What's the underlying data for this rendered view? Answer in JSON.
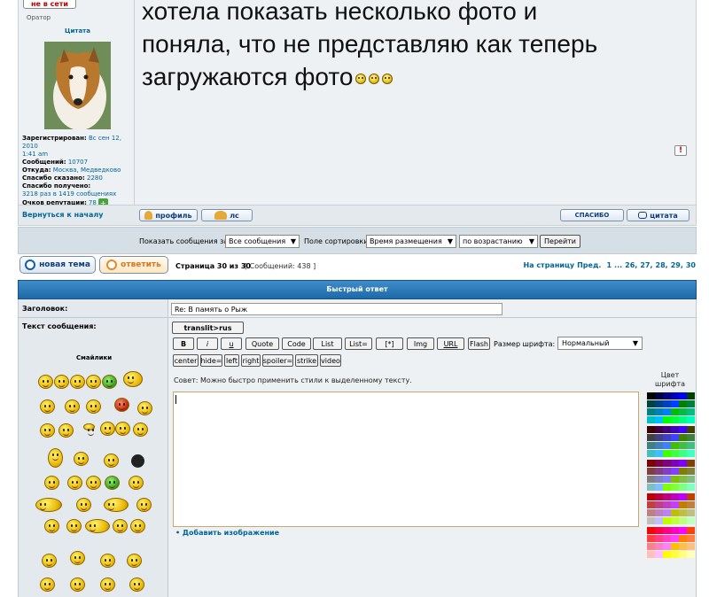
{
  "post": {
    "online_badge": "не в сети",
    "rank": "Оратор",
    "quote_label": "Цитата",
    "message_lines": [
      "хотела показать несколько фото и",
      "поняла, что не представляю как теперь",
      "загружаются фото"
    ],
    "stats": {
      "registered_label": "Зарегистрирован:",
      "registered_value": "Вс сен 12, 2010",
      "registered_time": "1:41 am",
      "messages_label": "Сообщений:",
      "messages_value": "10707",
      "from_label": "Откуда:",
      "from_value": "Москва, Медведково",
      "thanks_said_label": "Спасибо сказано:",
      "thanks_said_value": "2280",
      "thanks_received_label": "Спасибо получено:",
      "thanks_received_value": "3218 раз в 1419 сообщениях",
      "reputation_label": "Очков репутации:",
      "reputation_value": "78"
    },
    "back_to_top": "Вернуться к началу",
    "profile_button": "профиль",
    "pm_button": "лс",
    "thanks_button": "спасибо",
    "quote_button": "цитата"
  },
  "sort_bar": {
    "show_label": "Показать сообщения за:",
    "show_value": "Все сообщения",
    "sort_label": "Поле сортировки",
    "sort_value": "Время размещения",
    "order_value": "по возрастанию",
    "go_button": "Перейти"
  },
  "pagination": {
    "new_topic": "новая тема",
    "reply": "ответить",
    "page_info": "Страница 30 из 30",
    "message_count": "[ Сообщений: 438 ]",
    "goto_label": "На страницу",
    "prev": "Пред.",
    "pages": [
      "1",
      "...",
      "26,",
      "27,",
      "28,",
      "29,",
      "30"
    ]
  },
  "quick_reply": {
    "title": "Быстрый ответ",
    "subject_label": "Заголовок:",
    "subject_value": "Re: В память о Рыж",
    "text_label": "Текст сообщения:",
    "smilies_label": "Смайлики",
    "translit_button": "translit>rus",
    "format_row1": [
      "B",
      "i",
      "u",
      "Quote",
      "Code",
      "List",
      "List=",
      "[*]",
      "Img",
      "URL",
      "Flash"
    ],
    "font_size_label": "Размер шрифта:",
    "font_size_value": "Нормальный",
    "format_row2": [
      "center",
      "hide=",
      "left",
      "right",
      "spoiler=",
      "strike",
      "video"
    ],
    "tip": "Совет: Можно быстро применить стили к выделенному тексту.",
    "color_label_1": "Цвет",
    "color_label_2": "шрифта",
    "add_image": "Добавить изображение"
  },
  "colors": {
    "header_blue": "#1d6aa8",
    "link_blue": "#006597",
    "panel_bg": "#eef2f6",
    "row_bg": "#dde4eb"
  }
}
